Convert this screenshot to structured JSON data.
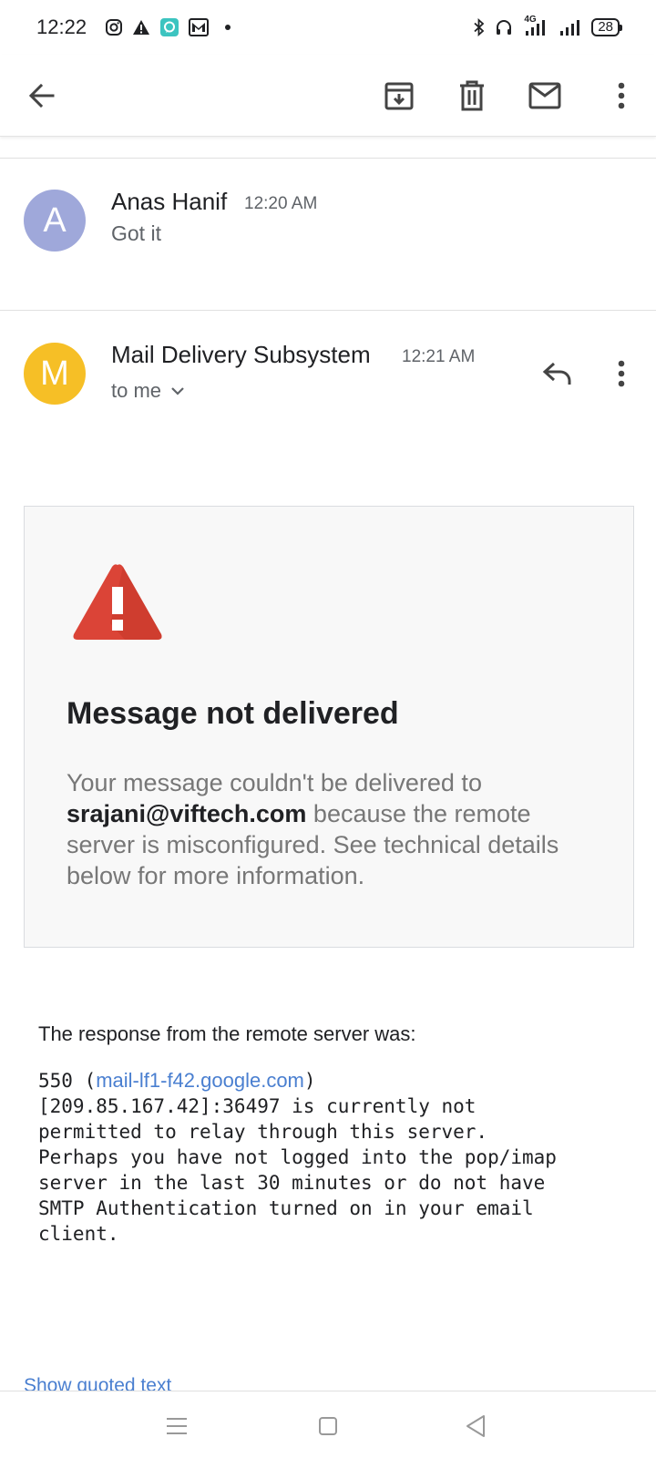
{
  "status_bar": {
    "time": "12:22",
    "left_icons": [
      "instagram-icon",
      "warning-icon",
      "chat-app-icon",
      "gmail-icon"
    ],
    "network_label": "4G",
    "battery_level": "28"
  },
  "toolbar": {
    "actions": [
      "back",
      "archive",
      "delete",
      "mark-unread",
      "more"
    ]
  },
  "messages": [
    {
      "avatar_letter": "A",
      "avatar_color": "#9fa8da",
      "sender": "Anas Hanif",
      "time": "12:20 AM",
      "snippet": "Got it"
    },
    {
      "avatar_letter": "M",
      "avatar_color": "#f6bf26",
      "sender": "Mail Delivery Subsystem",
      "time": "12:21 AM",
      "recipient_label": "to me"
    }
  ],
  "bounce": {
    "title": "Message not delivered",
    "body_prefix": "Your message couldn't be delivered to ",
    "recipient_email": "srajani@viftech.com",
    "body_suffix": " because the remote server is misconfigured. See technical details below for more information.",
    "response_label": "The response from the remote server was:",
    "response_code_prefix": "550 (",
    "response_link": "mail-lf1-f42.google.com",
    "response_code_suffix": ")\n[209.85.167.42]:36497 is currently not\npermitted to relay through this server.\nPerhaps you have not logged into the pop/imap\nserver in the last 30 minutes or do not have\nSMTP Authentication turned on in your email\nclient."
  },
  "show_quoted_text": "Show quoted text",
  "colors": {
    "warning_red": "#db4437",
    "link_blue": "#4a7fd0"
  }
}
